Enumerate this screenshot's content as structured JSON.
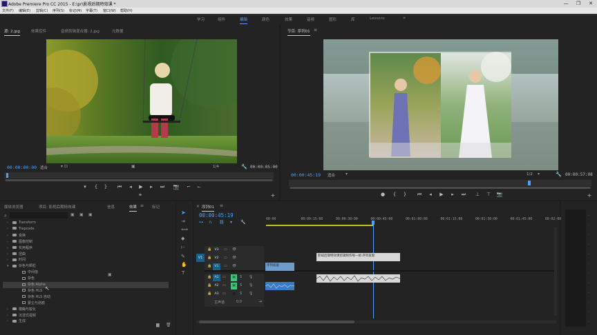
{
  "app": {
    "title": "Adobe Premiere Pro CC 2015 - E:\\pr\\影视后期特效课 *",
    "window_controls": [
      "—",
      "❐",
      "✕"
    ]
  },
  "menu": [
    "文件(F)",
    "编辑(E)",
    "剪辑(C)",
    "序列(S)",
    "标记(M)",
    "字幕(T)",
    "窗口(W)",
    "帮助(H)"
  ],
  "workspaces": {
    "items": [
      "学习",
      "组件",
      "编辑",
      "颜色",
      "效果",
      "音频",
      "图形",
      "库",
      "Lessons"
    ],
    "active_index": 2,
    "more": "»"
  },
  "source": {
    "tabs": [
      "源: 2.jpg",
      "效果控件",
      "音频剪辑混合器: 2.jpg",
      "元数据"
    ],
    "timecode_in": "00:00:00:00",
    "fit": "适合",
    "page": "1/4",
    "timecode_out": "00:00:05:00"
  },
  "program": {
    "tab": "节目: 序列01",
    "timecode": "00:00:45:19",
    "fit": "适合",
    "page": "1/2",
    "duration": "00:00:57:08"
  },
  "effects_panel": {
    "tabs": [
      "媒体浏览器",
      "项目: 影视后期特效课",
      "信息",
      "效果",
      "标记"
    ],
    "active_tab": 3,
    "tree": [
      {
        "label": "Transform",
        "type": "folder",
        "indent": 1
      },
      {
        "label": "Trapcode",
        "type": "folder",
        "indent": 1
      },
      {
        "label": "变换",
        "type": "folder",
        "indent": 1
      },
      {
        "label": "图像控制",
        "type": "folder",
        "indent": 1
      },
      {
        "label": "实用程序",
        "type": "folder",
        "indent": 1
      },
      {
        "label": "扭曲",
        "type": "folder",
        "indent": 1
      },
      {
        "label": "时间",
        "type": "folder",
        "indent": 1
      },
      {
        "label": "杂色与颗粒",
        "type": "folder",
        "indent": 1,
        "expanded": true
      },
      {
        "label": "中间值",
        "type": "fx",
        "indent": 2
      },
      {
        "label": "杂色",
        "type": "fx",
        "indent": 2
      },
      {
        "label": "杂色 Alpha",
        "type": "fx",
        "indent": 2,
        "selected": true
      },
      {
        "label": "杂色 HLS",
        "type": "fx",
        "indent": 2
      },
      {
        "label": "杂色 HLS 自动",
        "type": "fx",
        "indent": 2
      },
      {
        "label": "蒙尘与划痕",
        "type": "fx",
        "indent": 2
      },
      {
        "label": "模糊与锐化",
        "type": "folder",
        "indent": 1
      },
      {
        "label": "沉浸式视频",
        "type": "folder",
        "indent": 1
      },
      {
        "label": "生成",
        "type": "folder",
        "indent": 1
      }
    ]
  },
  "timeline": {
    "tab": "序列01",
    "timecode": "00:00:45:19",
    "ruler": [
      "00:00",
      "00:00:15:00",
      "00:00:30:00",
      "00:00:45:00",
      "00:01:00:00",
      "00:01:15:00",
      "00:01:30:00",
      "00:01:45:00",
      "00:02:00:0"
    ],
    "video_tracks": [
      "V3",
      "V2",
      "V1"
    ],
    "audio_tracks": [
      "A1",
      "A2",
      "A3"
    ],
    "master": {
      "label": "主声道",
      "value": "0.0"
    },
    "clips": {
      "v1_a": "序列嵌套",
      "v1_b": "影视后期特效课剪辑制作每一帧·序列嵌套"
    },
    "solo_letter": "S",
    "mute_letter": "M"
  },
  "colors": {
    "accent": "#4ea1ff",
    "clip_video": "#6f9dc9",
    "clip_audio": "#3c7bbf",
    "clip_light": "#d8d8d8",
    "track_active": "#1c5f8a",
    "track_green": "#3fc47a"
  }
}
